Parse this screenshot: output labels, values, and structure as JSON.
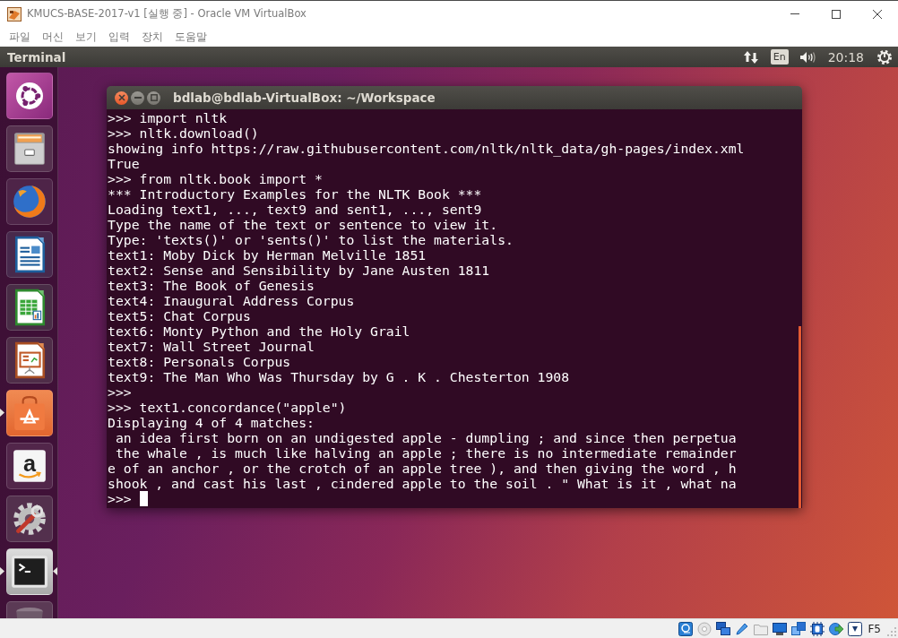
{
  "window": {
    "title": "KMUCS-BASE-2017-v1 [실행 중] - Oracle VM VirtualBox"
  },
  "menu": [
    {
      "label": "파일"
    },
    {
      "label": "머신"
    },
    {
      "label": "보기"
    },
    {
      "label": "입력"
    },
    {
      "label": "장치"
    },
    {
      "label": "도움말"
    }
  ],
  "top_panel": {
    "app_name": "Terminal",
    "keyboard_layout": "En",
    "clock": "20:18"
  },
  "launcher": {
    "items": [
      {
        "kind": "dash",
        "running": false,
        "focused": false
      },
      {
        "kind": "files",
        "running": false,
        "focused": false
      },
      {
        "kind": "browser",
        "running": false,
        "focused": false
      },
      {
        "kind": "writer",
        "running": false,
        "focused": false
      },
      {
        "kind": "calc",
        "running": false,
        "focused": false
      },
      {
        "kind": "impress",
        "running": false,
        "focused": false
      },
      {
        "kind": "software",
        "running": true,
        "focused": false
      },
      {
        "kind": "store",
        "glyph": "a",
        "running": false,
        "focused": false
      },
      {
        "kind": "settings",
        "running": false,
        "focused": false
      },
      {
        "kind": "terminal",
        "running": true,
        "focused": true
      },
      {
        "kind": "trash",
        "running": false,
        "focused": false
      }
    ]
  },
  "terminal": {
    "title": "bdlab@bdlab-VirtualBox: ~/Workspace",
    "lines": [
      ">>> import nltk",
      ">>> nltk.download()",
      "showing info https://raw.githubusercontent.com/nltk/nltk_data/gh-pages/index.xml",
      "True",
      ">>> from nltk.book import *",
      "*** Introductory Examples for the NLTK Book ***",
      "Loading text1, ..., text9 and sent1, ..., sent9",
      "Type the name of the text or sentence to view it.",
      "Type: 'texts()' or 'sents()' to list the materials.",
      "text1: Moby Dick by Herman Melville 1851",
      "text2: Sense and Sensibility by Jane Austen 1811",
      "text3: The Book of Genesis",
      "text4: Inaugural Address Corpus",
      "text5: Chat Corpus",
      "text6: Monty Python and the Holy Grail",
      "text7: Wall Street Journal",
      "text8: Personals Corpus",
      "text9: The Man Who Was Thursday by G . K . Chesterton 1908",
      ">>>",
      ">>> text1.concordance(\"apple\")",
      "Displaying 4 of 4 matches:",
      " an idea first born on an undigested apple - dumpling ; and since then perpetua",
      " the whale , is much like halving an apple ; there is no intermediate remainder",
      "e of an anchor , or the crotch of an apple tree ), and then giving the word , h",
      "shook , and cast his last , cindered apple to the soil . \" What is it , what na",
      ">>>"
    ],
    "cursor": true
  },
  "status_bar": {
    "host_key": "F5"
  }
}
